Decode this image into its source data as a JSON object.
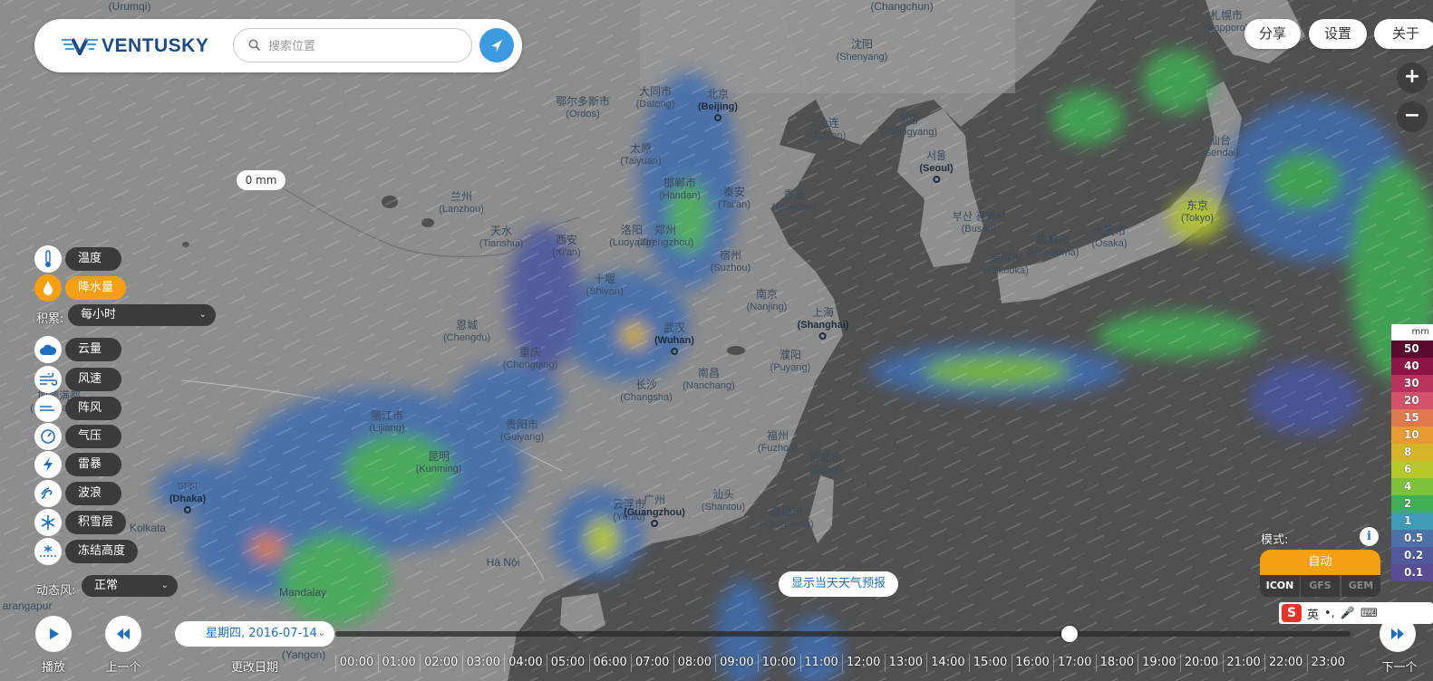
{
  "app": {
    "brand": "VENTUSKY"
  },
  "search": {
    "placeholder": "搜索位置"
  },
  "top_buttons": {
    "share": "分享",
    "settings": "设置",
    "about": "关于"
  },
  "zoom": {
    "in": "+",
    "out": "−"
  },
  "map": {
    "value_pill": "0 mm",
    "cities": [
      {
        "zh": "(Urumqi)",
        "en": "",
        "bold": false
      },
      {
        "zh": "(Changchun)",
        "en": "",
        "bold": false
      },
      {
        "zh": "札幌市",
        "en": "(Sapporo)",
        "bold": false
      },
      {
        "zh": "沈阳",
        "en": "(Shenyang)",
        "bold": false
      },
      {
        "zh": "鄂尔多斯市",
        "en": "(Ordos)",
        "bold": false
      },
      {
        "zh": "大同市",
        "en": "(Datong)",
        "bold": false
      },
      {
        "zh": "北京",
        "en": "(Beijing)",
        "bold": true
      },
      {
        "zh": "大连",
        "en": "(Dalian)",
        "bold": false
      },
      {
        "zh": "평양",
        "en": "(Pyongyang)",
        "bold": false
      },
      {
        "zh": "仙台",
        "en": "(Sendai)",
        "bold": false
      },
      {
        "zh": "太原",
        "en": "(Taiyuan)",
        "bold": false
      },
      {
        "zh": "邯郸市",
        "en": "(Handan)",
        "bold": false
      },
      {
        "zh": "서울",
        "en": "(Seoul)",
        "bold": true
      },
      {
        "zh": "兰州",
        "en": "(Lanzhou)",
        "bold": false
      },
      {
        "zh": "泰安",
        "en": "(Tai'an)",
        "bold": false
      },
      {
        "zh": "青岛",
        "en": "(Qingdao)",
        "bold": false
      },
      {
        "zh": "东京",
        "en": "(Tokyo)",
        "bold": false
      },
      {
        "zh": "天水",
        "en": "(Tianshui)",
        "bold": false
      },
      {
        "zh": "西安",
        "en": "(Xi'an)",
        "bold": false
      },
      {
        "zh": "洛阳",
        "en": "(Luoyang)",
        "bold": false
      },
      {
        "zh": "郑州",
        "en": "(Zhengzhou)",
        "bold": false
      },
      {
        "zh": "부산 광역시",
        "en": "(Busan)",
        "bold": false
      },
      {
        "zh": "広島市",
        "en": "(Hiroshima)",
        "bold": false
      },
      {
        "zh": "大阪市",
        "en": "(Osaka)",
        "bold": false
      },
      {
        "zh": "福岡市",
        "en": "(Fukuoka)",
        "bold": false
      },
      {
        "zh": "宿州",
        "en": "(Suzhou)",
        "bold": false
      },
      {
        "zh": "十堰",
        "en": "(Shiyan)",
        "bold": false
      },
      {
        "zh": "南京",
        "en": "(Nanjing)",
        "bold": false
      },
      {
        "zh": "上海",
        "en": "(Shanghai)",
        "bold": true
      },
      {
        "zh": "恩城",
        "en": "(Chengdu)",
        "bold": false
      },
      {
        "zh": "武汉",
        "en": "(Wuhan)",
        "bold": true
      },
      {
        "zh": "重庆",
        "en": "(Chongqing)",
        "bold": false
      },
      {
        "zh": "濮阳",
        "en": "(Puyang)",
        "bold": false
      },
      {
        "zh": "南昌",
        "en": "(Nanchang)",
        "bold": false
      },
      {
        "zh": "长沙",
        "en": "(Changsha)",
        "bold": false
      },
      {
        "zh": "加德满都",
        "en": "(Kathmandu)",
        "bold": false
      },
      {
        "zh": "丽江市",
        "en": "(Lijiang)",
        "bold": false
      },
      {
        "zh": "贵阳市",
        "en": "(Guiyang)",
        "bold": false
      },
      {
        "zh": "福州",
        "en": "(Fuzhou)",
        "bold": false
      },
      {
        "zh": "台北市",
        "en": "(Taipei)",
        "bold": false
      },
      {
        "zh": "昆明",
        "en": "(Kunming)",
        "bold": false
      },
      {
        "zh": "ঢাকা",
        "en": "(Dhaka)",
        "bold": true
      },
      {
        "zh": "云浮市",
        "en": "(Yunfu)",
        "bold": false
      },
      {
        "zh": "广州",
        "en": "(Guangzhou)",
        "bold": true
      },
      {
        "zh": "汕头",
        "en": "(Shantou)",
        "bold": false
      },
      {
        "zh": "高雄市",
        "en": "(Kaohsiung)",
        "bold": false
      },
      {
        "zh": "Kolkata",
        "en": "",
        "bold": false
      },
      {
        "zh": "Mandalay",
        "en": "",
        "bold": false
      },
      {
        "zh": "Hà Nội",
        "en": "",
        "bold": false
      },
      {
        "zh": "arangapur",
        "en": "",
        "bold": false
      },
      {
        "zh": "(Yangon)",
        "en": "",
        "bold": false
      }
    ]
  },
  "layers": {
    "items": [
      {
        "label": "温度",
        "icon": "thermometer-icon",
        "active": false
      },
      {
        "label": "降水量",
        "icon": "raindrop-icon",
        "active": true
      },
      {
        "label": "云量",
        "icon": "cloud-icon",
        "active": false
      },
      {
        "label": "风速",
        "icon": "wind-icon",
        "active": false
      },
      {
        "label": "阵风",
        "icon": "gust-icon",
        "active": false
      },
      {
        "label": "气压",
        "icon": "pressure-icon",
        "active": false
      },
      {
        "label": "雷暴",
        "icon": "lightning-icon",
        "active": false
      },
      {
        "label": "波浪",
        "icon": "wave-icon",
        "active": false
      },
      {
        "label": "积雪层",
        "icon": "snowflake-icon",
        "active": false
      },
      {
        "label": "冻结高度",
        "icon": "freezing-level-icon",
        "active": false
      }
    ],
    "accumulation_label": "积累:",
    "accumulation_value": "每小时",
    "dynamic_wind_label": "动态风:",
    "dynamic_wind_value": "正常"
  },
  "legend": {
    "unit": "mm",
    "entries": [
      {
        "value": "50",
        "color": "#5a0a2c"
      },
      {
        "value": "40",
        "color": "#8c1545"
      },
      {
        "value": "30",
        "color": "#b8335e"
      },
      {
        "value": "20",
        "color": "#d5526b"
      },
      {
        "value": "15",
        "color": "#e07a4c"
      },
      {
        "value": "10",
        "color": "#e89a32"
      },
      {
        "value": "8",
        "color": "#d6b428"
      },
      {
        "value": "6",
        "color": "#b5c92a"
      },
      {
        "value": "4",
        "color": "#7cc23a"
      },
      {
        "value": "2",
        "color": "#3fae55"
      },
      {
        "value": "1",
        "color": "#3f9ab4"
      },
      {
        "value": "0.5",
        "color": "#4c72a9"
      },
      {
        "value": "0.2",
        "color": "#525a9e"
      },
      {
        "value": "0.1",
        "color": "#5a4d94"
      }
    ]
  },
  "mode": {
    "label": "模式:",
    "auto": "自动",
    "models": [
      "ICON",
      "GFS",
      "GEM"
    ],
    "active_model": "ICON"
  },
  "forecast_button": "显示当天天气预报",
  "timeline": {
    "play_label": "播放",
    "prev_label": "上一个",
    "next_label": "下一个",
    "change_date_label": "更改日期",
    "date": "星期四, 2016-07-14",
    "hours": [
      "00:00",
      "01:00",
      "02:00",
      "03:00",
      "04:00",
      "05:00",
      "06:00",
      "07:00",
      "08:00",
      "09:00",
      "10:00",
      "11:00",
      "12:00",
      "13:00",
      "14:00",
      "15:00",
      "16:00",
      "17:00",
      "18:00",
      "19:00",
      "20:00",
      "21:00",
      "22:00",
      "23:00"
    ],
    "current_hour": "17:00"
  },
  "ime": {
    "lang": "英",
    "punct": "•,"
  }
}
